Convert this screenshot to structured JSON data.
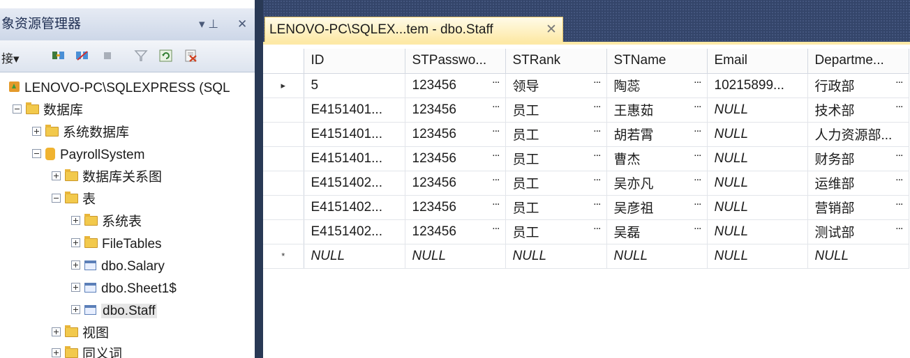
{
  "object_explorer": {
    "title": "象资源管理器",
    "pin_glyph": "▾ ⊥",
    "close_glyph": "✕",
    "connect_label": "接▾",
    "tree": [
      {
        "label": "LENOVO-PC\\SQLEXPRESS (SQL",
        "icon": "server-icon",
        "level": 0,
        "expander": "none"
      },
      {
        "label": "数据库",
        "icon": "folder-icon",
        "level": 1,
        "expander": "minus"
      },
      {
        "label": "系统数据库",
        "icon": "folder-icon",
        "level": 2,
        "expander": "plus"
      },
      {
        "label": "PayrollSystem",
        "icon": "database-icon",
        "level": 2,
        "expander": "minus"
      },
      {
        "label": "数据库关系图",
        "icon": "folder-icon",
        "level": 3,
        "expander": "plus"
      },
      {
        "label": "表",
        "icon": "folder-icon",
        "level": 3,
        "expander": "minus"
      },
      {
        "label": "系统表",
        "icon": "folder-icon",
        "level": 4,
        "expander": "plus"
      },
      {
        "label": "FileTables",
        "icon": "folder-icon",
        "level": 4,
        "expander": "plus"
      },
      {
        "label": "dbo.Salary",
        "icon": "table-icon",
        "level": 4,
        "expander": "plus"
      },
      {
        "label": "dbo.Sheet1$",
        "icon": "table-icon",
        "level": 4,
        "expander": "plus"
      },
      {
        "label": "dbo.Staff",
        "icon": "table-icon",
        "level": 4,
        "expander": "plus",
        "selected": true
      },
      {
        "label": "视图",
        "icon": "folder-icon",
        "level": 3,
        "expander": "plus"
      },
      {
        "label": "同义词",
        "icon": "folder-icon",
        "level": 3,
        "expander": "plus"
      }
    ]
  },
  "document_tab": {
    "title": "LENOVO-PC\\SQLEX...tem - dbo.Staff",
    "close_glyph": "✕"
  },
  "grid": {
    "columns": [
      "ID",
      "STPasswo...",
      "STRank",
      "STName",
      "Email",
      "Departme..."
    ],
    "rows": [
      {
        "marker": "▸",
        "cells": [
          "5",
          "123456",
          "领导",
          "陶蕊",
          "10215899...",
          "行政部"
        ]
      },
      {
        "marker": "",
        "cells": [
          "E4151401...",
          "123456",
          "员工",
          "王惠茹",
          "NULL",
          "技术部"
        ]
      },
      {
        "marker": "",
        "cells": [
          "E4151401...",
          "123456",
          "员工",
          "胡若霄",
          "NULL",
          "人力资源部..."
        ]
      },
      {
        "marker": "",
        "cells": [
          "E4151401...",
          "123456",
          "员工",
          "曹杰",
          "NULL",
          "财务部"
        ]
      },
      {
        "marker": "",
        "cells": [
          "E4151402...",
          "123456",
          "员工",
          "吴亦凡",
          "NULL",
          "运维部"
        ]
      },
      {
        "marker": "",
        "cells": [
          "E4151402...",
          "123456",
          "员工",
          "吴彦祖",
          "NULL",
          "营销部"
        ]
      },
      {
        "marker": "",
        "cells": [
          "E4151402...",
          "123456",
          "员工",
          "吴磊",
          "NULL",
          "测试部"
        ]
      },
      {
        "marker": "*",
        "cells": [
          "NULL",
          "NULL",
          "NULL",
          "NULL",
          "NULL",
          "NULL"
        ]
      }
    ],
    "ellipsis_glyph": "...",
    "null_text": "NULL"
  },
  "colors": {
    "tab_active": "#fde9a6",
    "chrome": "#293955",
    "folder": "#f2c94c"
  }
}
